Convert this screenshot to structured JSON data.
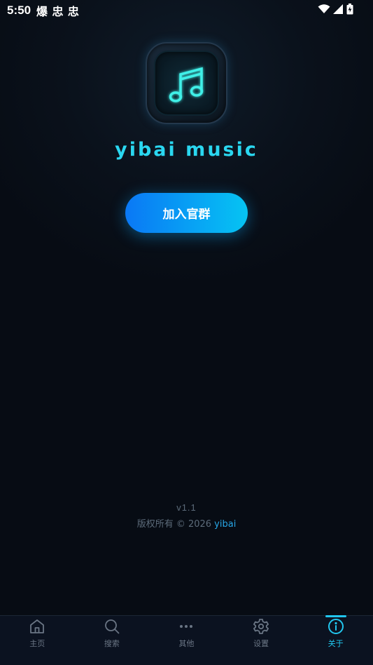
{
  "status_bar": {
    "time": "5:50",
    "app_icons_text": "爆 忠 忠"
  },
  "app": {
    "title": "yibai music",
    "join_button_label": "加入官群",
    "version": "v1.1",
    "copyright_prefix": "版权所有 © 2026 ",
    "copyright_brand": "yibai"
  },
  "bottom_nav": {
    "items": [
      {
        "label": "主页",
        "icon": "home-icon"
      },
      {
        "label": "搜索",
        "icon": "search-icon"
      },
      {
        "label": "其他",
        "icon": "more-icon"
      },
      {
        "label": "设置",
        "icon": "gear-icon"
      },
      {
        "label": "关于",
        "icon": "info-icon"
      }
    ],
    "active_index": 4
  },
  "colors": {
    "accent": "#21c6ee",
    "title": "#2ad7f0",
    "background": "#070c14",
    "button_gradient_start": "#0a78f5",
    "button_gradient_end": "#06c4f3"
  }
}
